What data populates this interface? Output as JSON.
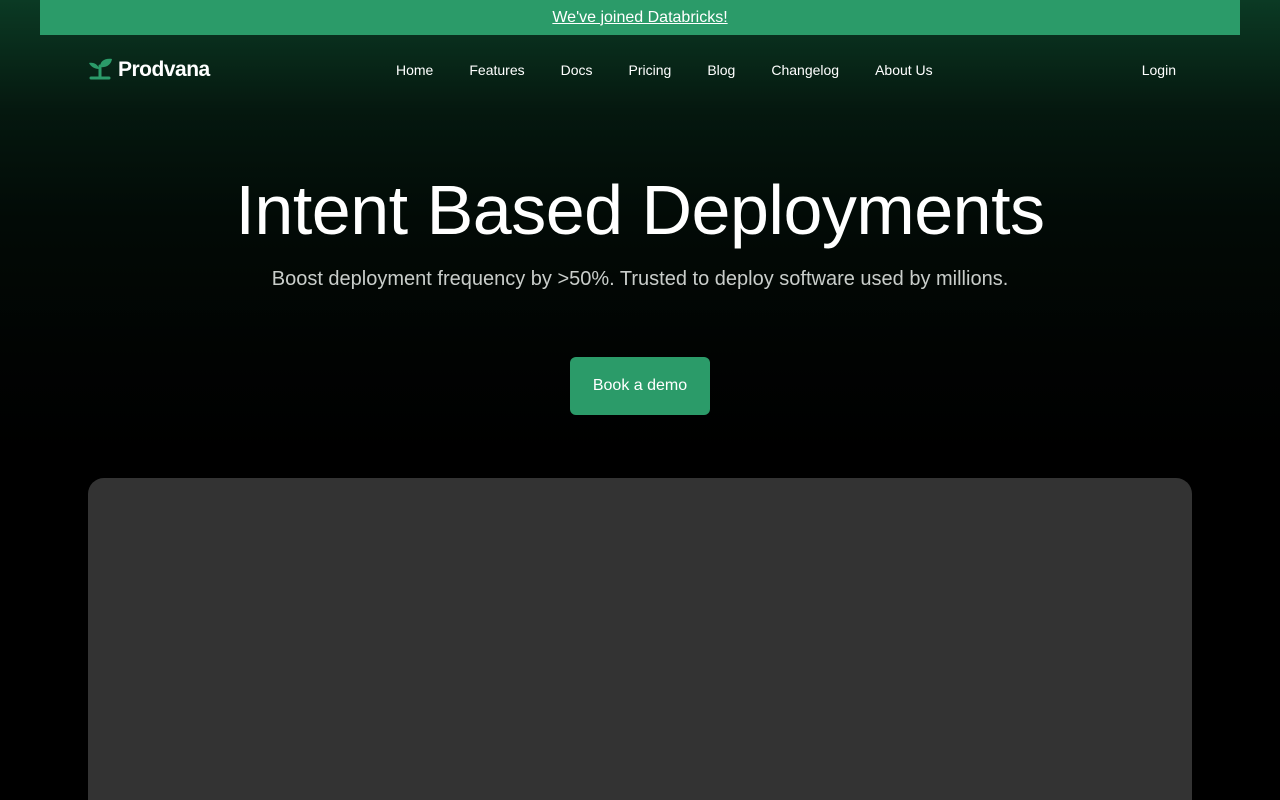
{
  "announcement": {
    "text": "We've joined Databricks!"
  },
  "brand": {
    "name": "Prodvana",
    "logo_icon": "sprout-icon",
    "accent_color": "#2b9b69"
  },
  "nav": {
    "links": [
      "Home",
      "Features",
      "Docs",
      "Pricing",
      "Blog",
      "Changelog",
      "About Us"
    ],
    "login_label": "Login"
  },
  "hero": {
    "title": "Intent Based Deployments",
    "subtitle": "Boost deployment frequency by >50%. Trusted to deploy software used by millions.",
    "cta_label": "Book a demo"
  },
  "colors": {
    "background": "#000000",
    "panel": "#333333",
    "subtitle": "#c9cdca"
  }
}
